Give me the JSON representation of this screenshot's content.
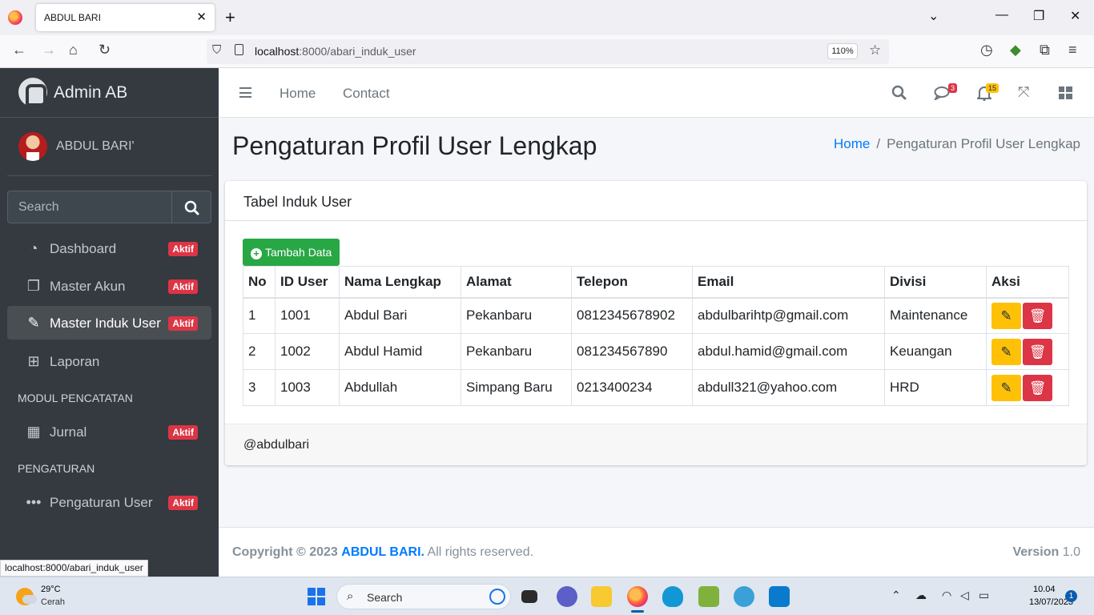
{
  "browser": {
    "tab_title": "ABDUL BARI",
    "url_host": "localhost",
    "url_path": ":8000/abari_induk_user",
    "zoom": "110%",
    "status_url": "localhost:8000/abari_induk_user"
  },
  "sidebar": {
    "brand": "Admin AB",
    "user_name": "ABDUL BARI'",
    "search_placeholder": "Search",
    "items": [
      {
        "label": "Dashboard",
        "badge": "Aktif",
        "icon": "tachometer-icon"
      },
      {
        "label": "Master Akun",
        "badge": "Aktif",
        "icon": "copy-icon"
      },
      {
        "label": "Master Induk User",
        "badge": "Aktif",
        "icon": "edit-icon",
        "active": true
      },
      {
        "label": "Laporan",
        "badge": "",
        "icon": "table-icon"
      }
    ],
    "header_modul": "MODUL PENCATATAN",
    "jurnal": {
      "label": "Jurnal",
      "badge": "Aktif"
    },
    "header_pengaturan": "PENGATURAN",
    "pengaturan_user": {
      "label": "Pengaturan User",
      "badge": "Aktif"
    }
  },
  "topnav": {
    "home": "Home",
    "contact": "Contact",
    "messages_count": "3",
    "notifications_count": "15"
  },
  "content": {
    "title": "Pengaturan Profil User Lengkap",
    "breadcrumb_home": "Home",
    "breadcrumb_current": "Pengaturan Profil User Lengkap"
  },
  "card": {
    "title": "Tabel Induk User",
    "add_button": "Tambah Data",
    "columns": [
      "No",
      "ID User",
      "Nama Lengkap",
      "Alamat",
      "Telepon",
      "Email",
      "Divisi",
      "Aksi"
    ],
    "rows": [
      [
        "1",
        "1001",
        "Abdul Bari",
        "Pekanbaru",
        "0812345678902",
        "abdulbarihtp@gmail.com",
        "Maintenance"
      ],
      [
        "2",
        "1002",
        "Abdul Hamid",
        "Pekanbaru",
        "081234567890",
        "abdul.hamid@gmail.com",
        "Keuangan"
      ],
      [
        "3",
        "1003",
        "Abdullah",
        "Simpang Baru",
        "0213400234",
        "abdull321@yahoo.com",
        "HRD"
      ]
    ],
    "footer": "@abdulbari"
  },
  "footer": {
    "copyright_prefix": "Copyright © 2023",
    "brand": "ABDUL BARI.",
    "suffix": "All rights reserved.",
    "version_label": "Version",
    "version_value": "1.0"
  },
  "taskbar": {
    "temp": "29°C",
    "condition": "Cerah",
    "search": "Search",
    "time": "10.04",
    "date": "13/07/2023",
    "notif_count": "1"
  },
  "colors": {
    "sidebar_bg": "#343a40",
    "primary": "#007bff",
    "success": "#28a745",
    "warning": "#ffc107",
    "danger": "#dc3545"
  }
}
